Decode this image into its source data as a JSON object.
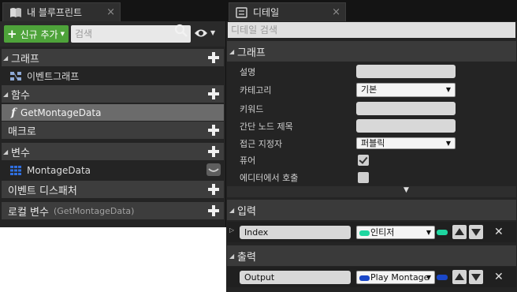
{
  "left": {
    "tab_title": "내 블루프린트",
    "add_button_label": "신규 추가",
    "search_placeholder": "검색",
    "sections": {
      "graph": "그래프",
      "functions": "함수",
      "macros": "매크로",
      "variables": "변수",
      "event_dispatchers": "이벤트 디스패처",
      "local_vars": "로컬 변수",
      "local_vars_scope": "(GetMontageData)"
    },
    "items": {
      "event_graph": "이벤트그래프",
      "function": "GetMontageData",
      "variable": "MontageData"
    }
  },
  "right": {
    "tab_title": "디테일",
    "search_placeholder": "디테일 검색",
    "graph_section": "그래프",
    "props": {
      "description": "설명",
      "category": "카테고리",
      "category_value": "기본",
      "keywords": "키워드",
      "compact_title": "간단 노드 제목",
      "access": "접근 지정자",
      "access_value": "퍼블릭",
      "pure": "퓨어",
      "call_in_editor": "에디터에서 호출"
    },
    "pure_checked": true,
    "call_in_editor_checked": false,
    "inputs_section": "입력",
    "outputs_section": "출력",
    "input_param": {
      "name": "Index",
      "type": "인티저",
      "color": "#1ed6a0"
    },
    "output_param": {
      "name": "Output",
      "type": "Play Montage",
      "color": "#1a47c8"
    }
  },
  "colors": {
    "add_button": "#4ea33a",
    "selected_row": "#6b6b6b",
    "panel_bg": "#242424"
  }
}
